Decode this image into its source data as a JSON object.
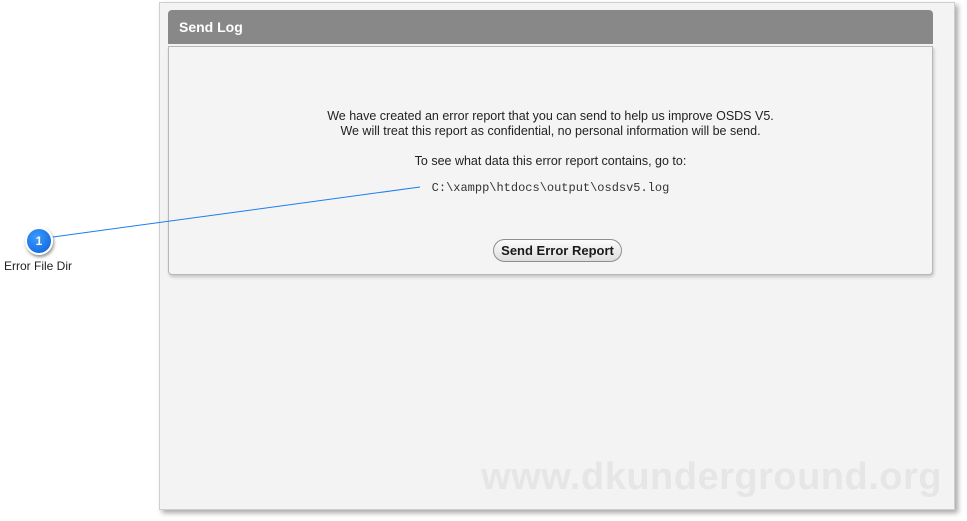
{
  "panel": {
    "title": "Send Log",
    "message_line1": "We have created an error report that you can send to help us improve OSDS V5.",
    "message_line2": "We will treat this report as confidential, no personal information will be send.",
    "message_line3": "To see what data this error report contains, go to:",
    "log_path": "C:\\xampp\\htdocs\\output\\osdsv5.log",
    "send_button_label": "Send Error Report"
  },
  "watermark": "www.dkunderground.org",
  "callout": {
    "number": "1",
    "label": "Error File Dir",
    "color": "#1a7ef0"
  }
}
